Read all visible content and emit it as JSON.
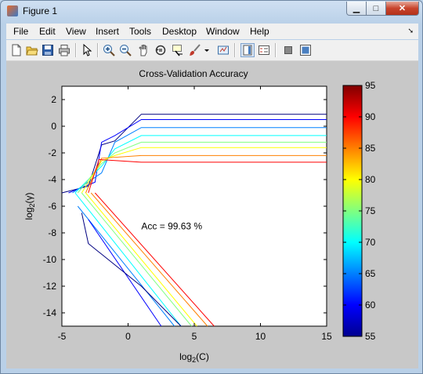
{
  "window": {
    "title": "Figure 1",
    "min_label": "▁",
    "max_label": "□",
    "close_label": "✕"
  },
  "menu": [
    {
      "label": "File"
    },
    {
      "label": "Edit"
    },
    {
      "label": "View"
    },
    {
      "label": "Insert"
    },
    {
      "label": "Tools"
    },
    {
      "label": "Desktop"
    },
    {
      "label": "Window"
    },
    {
      "label": "Help"
    }
  ],
  "toolbar": {
    "icons": [
      "new-figure-icon",
      "open-file-icon",
      "save-icon",
      "print-icon",
      "pointer-icon",
      "zoom-in-icon",
      "zoom-out-icon",
      "pan-icon",
      "rotate-3d-icon",
      "data-cursor-icon",
      "brush-icon",
      "dropdown-arrow-icon",
      "link-plot-icon",
      "insert-colorbar-icon",
      "insert-legend-icon",
      "hide-plot-tools-icon",
      "show-plot-tools-icon"
    ]
  },
  "chart_data": {
    "type": "contour",
    "title": "Cross-Validation Accuracy",
    "xlabel": "log2(C)",
    "ylabel": "log2(γ)",
    "xlim": [
      -5,
      15
    ],
    "ylim": [
      -15,
      3
    ],
    "xticks": [
      "-5",
      "0",
      "5",
      "10",
      "15"
    ],
    "yticks": [
      "2",
      "0",
      "-2",
      "-4",
      "-6",
      "-8",
      "-10",
      "-12",
      "-14"
    ],
    "annotation": {
      "text": "Acc = 99.63 %",
      "x": 1,
      "y": -7.5
    },
    "colorbar": {
      "min": 55,
      "max": 95,
      "ticks": [
        "95",
        "90",
        "85",
        "80",
        "75",
        "70",
        "65",
        "60",
        "55"
      ]
    },
    "series": [
      {
        "level": 55,
        "points": [
          [
            -5,
            -5
          ],
          [
            -3,
            -4.5
          ],
          [
            -2,
            -1.4
          ],
          [
            -1,
            -1.1
          ],
          [
            1,
            0.9
          ],
          [
            15,
            0.9
          ]
        ]
      },
      {
        "level": 60,
        "points": [
          [
            -4.5,
            -5
          ],
          [
            -2.5,
            -4.2
          ],
          [
            -2,
            -1.2
          ],
          [
            -1,
            -0.7
          ],
          [
            1,
            0.5
          ],
          [
            15,
            0.5
          ]
        ]
      },
      {
        "level": 65,
        "points": [
          [
            -4.2,
            -5
          ],
          [
            -2,
            -3.5
          ],
          [
            -1,
            -1.2
          ],
          [
            1,
            -0.1
          ],
          [
            15,
            -0.1
          ]
        ]
      },
      {
        "level": 70,
        "points": [
          [
            -4,
            -5
          ],
          [
            -2,
            -3
          ],
          [
            -1,
            -1.7
          ],
          [
            1,
            -0.7
          ],
          [
            15,
            -0.7
          ]
        ]
      },
      {
        "level": 75,
        "points": [
          [
            -3.8,
            -5
          ],
          [
            -2,
            -2.8
          ],
          [
            -1,
            -2
          ],
          [
            1,
            -1.2
          ],
          [
            15,
            -1.2
          ]
        ]
      },
      {
        "level": 80,
        "points": [
          [
            -3.5,
            -5
          ],
          [
            -2,
            -2.6
          ],
          [
            -1,
            -2.2
          ],
          [
            1,
            -1.6
          ],
          [
            15,
            -1.6
          ]
        ]
      },
      {
        "level": 85,
        "points": [
          [
            -3.2,
            -5
          ],
          [
            -2,
            -2.4
          ],
          [
            1,
            -2.2
          ],
          [
            15,
            -2.2
          ]
        ]
      },
      {
        "level": 90,
        "points": [
          [
            -3,
            -5
          ],
          [
            -2.2,
            -2.5
          ],
          [
            1,
            -2.7
          ],
          [
            15,
            -2.7
          ]
        ]
      },
      {
        "level": 90,
        "points": [
          [
            -2.5,
            -5
          ],
          [
            6.5,
            -15
          ]
        ]
      },
      {
        "level": 85,
        "points": [
          [
            -2.8,
            -5
          ],
          [
            6,
            -15
          ]
        ]
      },
      {
        "level": 80,
        "points": [
          [
            -3.2,
            -5
          ],
          [
            5.2,
            -15
          ]
        ]
      },
      {
        "level": 75,
        "points": [
          [
            -3.5,
            -5
          ],
          [
            4.8,
            -15
          ]
        ]
      },
      {
        "level": 70,
        "points": [
          [
            -4,
            -5
          ],
          [
            4,
            -15
          ]
        ]
      },
      {
        "level": 65,
        "points": [
          [
            -3.8,
            -6
          ],
          [
            3.5,
            -15
          ]
        ]
      },
      {
        "level": 60,
        "points": [
          [
            -3,
            -7
          ],
          [
            2.5,
            -15
          ]
        ]
      },
      {
        "level": 55,
        "points": [
          [
            -3.5,
            -6.5
          ],
          [
            -3,
            -8.8
          ],
          [
            1,
            -12
          ],
          [
            4,
            -15
          ]
        ]
      }
    ]
  }
}
